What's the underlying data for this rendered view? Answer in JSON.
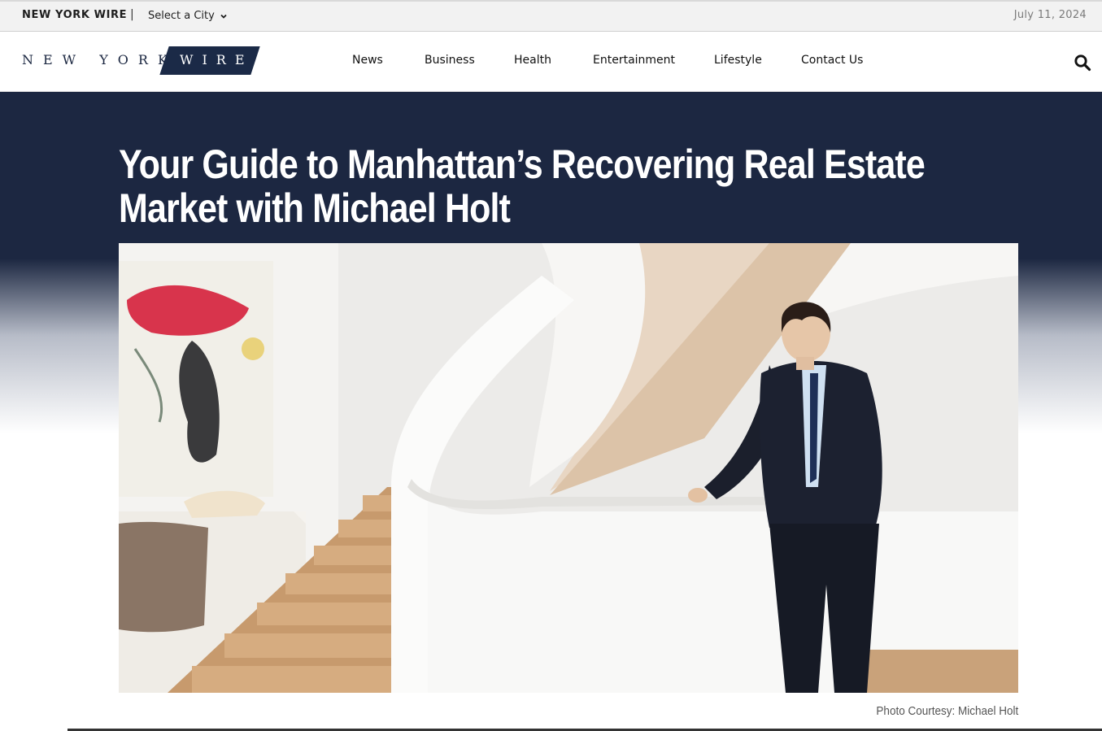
{
  "topbar": {
    "brand": "NEW YORK WIRE",
    "separator": "|",
    "city_select": "Select a City",
    "date": "July 11, 2024"
  },
  "logo": {
    "left_text": "NEW YORK",
    "right_text": "WIRE"
  },
  "nav": {
    "items": [
      {
        "label": "News"
      },
      {
        "label": "Business"
      },
      {
        "label": "Health"
      },
      {
        "label": "Entertainment"
      },
      {
        "label": "Lifestyle"
      },
      {
        "label": "Contact Us"
      }
    ],
    "search_icon": "search-icon"
  },
  "article": {
    "headline": "Your Guide to Manhattan’s Recovering Real Estate Market with Michael Holt",
    "photo_caption": "Photo Courtesy: Michael Holt"
  },
  "colors": {
    "navy": "#1c2741",
    "logo_slab": "#1b2a47",
    "topbar_bg": "#f2f2f2"
  }
}
